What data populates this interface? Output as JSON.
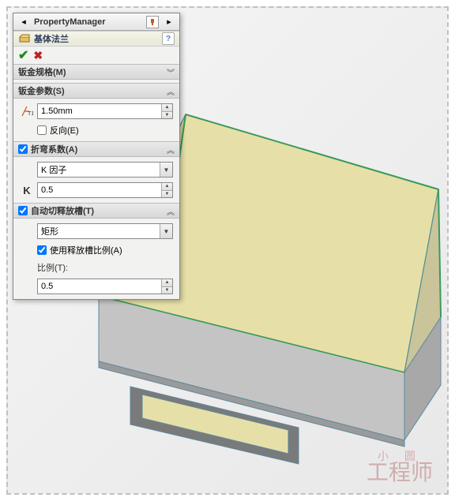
{
  "header": {
    "title": "PropertyManager"
  },
  "feature": {
    "title": "基体法兰"
  },
  "groups": {
    "gauge": {
      "label": "钣金规格(M)"
    },
    "params": {
      "label": "钣金参数(S)",
      "thickness": "1.50mm",
      "reverse_label": "反向(E)"
    },
    "bend": {
      "label": "折弯系数(A)",
      "method": "K 因子",
      "k_value": "0.5"
    },
    "relief": {
      "label": "自动切释放槽(T)",
      "type": "矩形",
      "use_ratio_label": "使用释放槽比例(A)",
      "ratio_label": "比例(T):",
      "ratio_value": "0.5"
    }
  },
  "watermark": {
    "line1": "小 圆",
    "line2": "工程师"
  }
}
